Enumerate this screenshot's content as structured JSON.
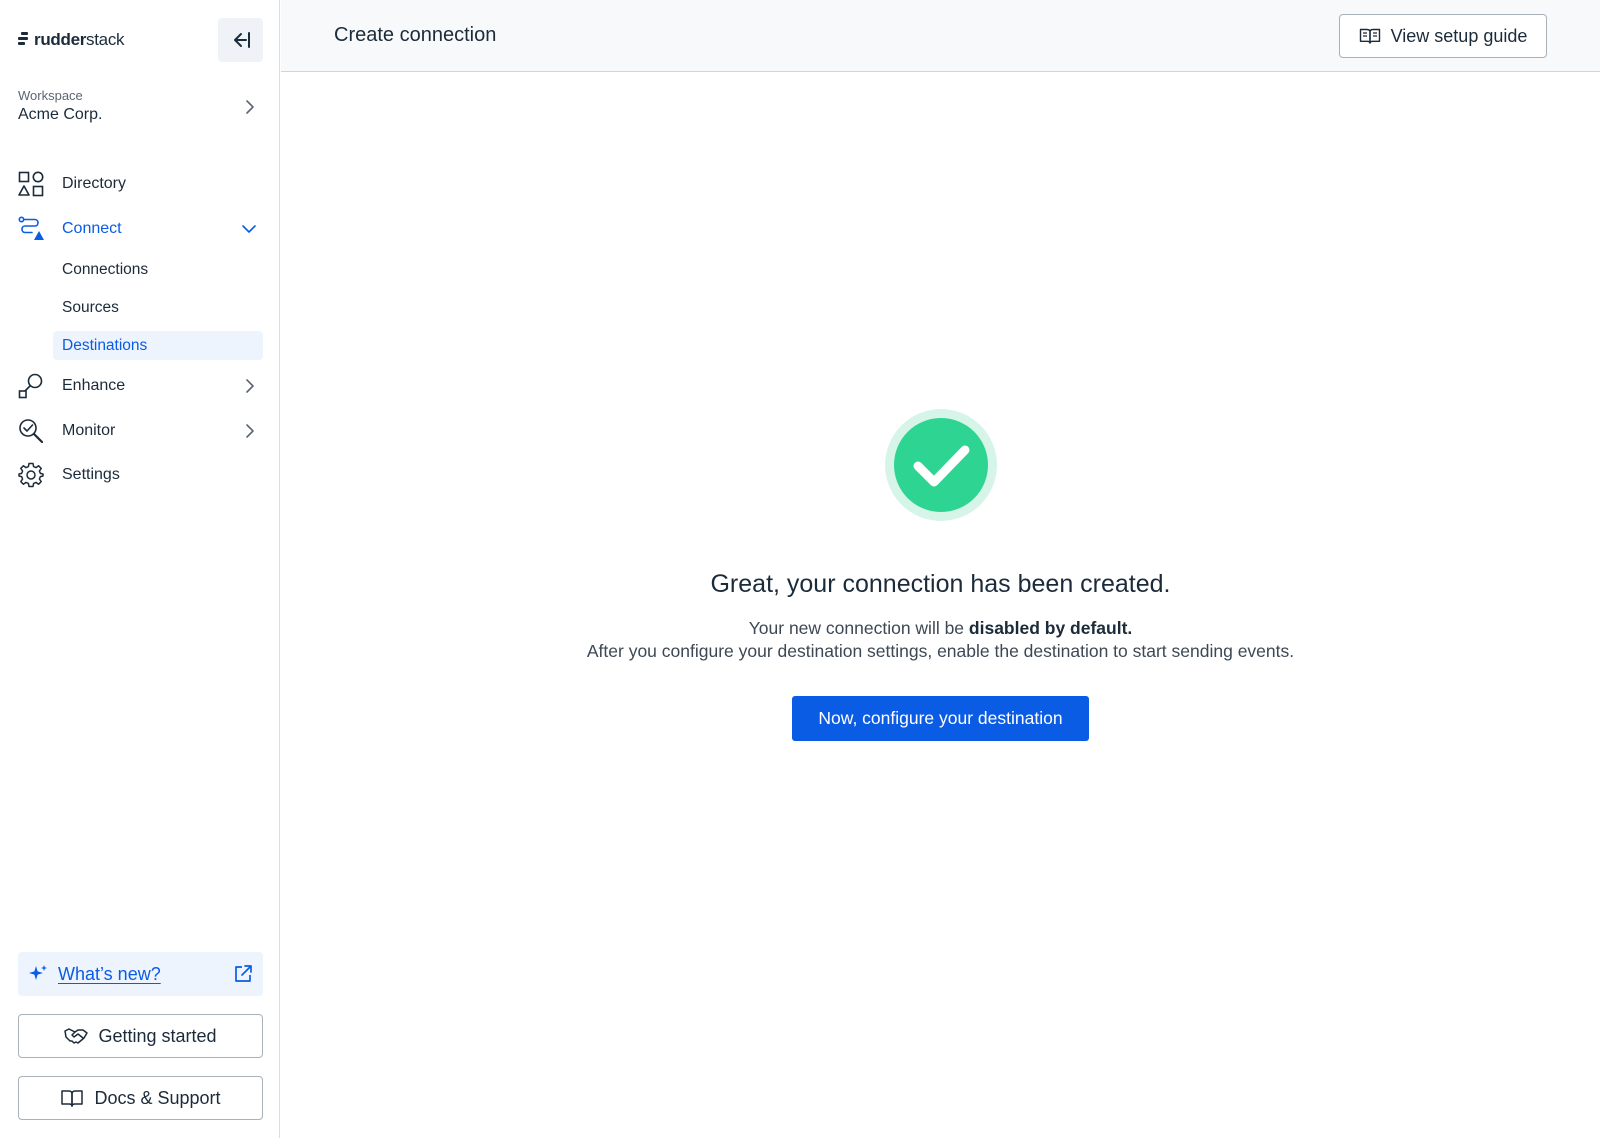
{
  "brand": {
    "name_bold": "rudder",
    "name_light": "stack"
  },
  "sidebar": {
    "workspace": {
      "label": "Workspace",
      "name": "Acme Corp."
    },
    "nav": {
      "directory": "Directory",
      "connect": "Connect",
      "enhance": "Enhance",
      "monitor": "Monitor",
      "settings": "Settings"
    },
    "connect_sub": {
      "connections": "Connections",
      "sources": "Sources",
      "destinations": "Destinations"
    },
    "whats_new": "What’s new?",
    "getting_started": "Getting started",
    "docs_support": "Docs & Support"
  },
  "header": {
    "title": "Create connection",
    "guide_button": "View setup guide"
  },
  "main": {
    "headline": "Great, your connection has been created.",
    "desc_prefix": "Your new connection will be ",
    "desc_bold": "disabled by default.",
    "desc_line2": "After you configure your destination settings, enable the destination to start sending events.",
    "cta": "Now, configure your destination"
  },
  "colors": {
    "accent": "#0b5ce5",
    "success": "#2dd492",
    "success_ring": "#d6f5e8",
    "text": "#1c2b3a"
  },
  "icons": [
    "collapse-sidebar-icon",
    "chevron-right-icon",
    "directory-icon",
    "connect-icon",
    "chevron-down-icon",
    "enhance-icon",
    "monitor-icon",
    "settings-gear-icon",
    "sparkle-icon",
    "external-link-icon",
    "handshake-icon",
    "book-icon",
    "check-circle-icon"
  ]
}
